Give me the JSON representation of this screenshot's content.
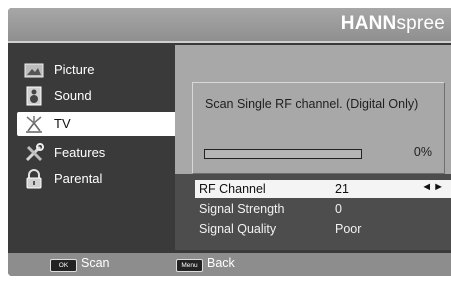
{
  "brand": {
    "bold": "HANN",
    "light": "spree"
  },
  "sidebar": {
    "items": [
      {
        "label": "Picture",
        "icon": "picture-icon",
        "selected": false
      },
      {
        "label": "Sound",
        "icon": "speaker-icon",
        "selected": false
      },
      {
        "label": "TV",
        "icon": "antenna-icon",
        "selected": true
      },
      {
        "label": "Features",
        "icon": "tools-icon",
        "selected": false
      },
      {
        "label": "Parental",
        "icon": "lock-icon",
        "selected": false
      }
    ]
  },
  "scan": {
    "title": "Scan Single RF channel. (Digital Only)",
    "progress_percent": 0,
    "progress_text": "0%"
  },
  "settings": {
    "rows": [
      {
        "label": "RF Channel",
        "value": "21",
        "selected": true,
        "arrows": "◄►"
      },
      {
        "label": "Signal Strength",
        "value": "0",
        "selected": false
      },
      {
        "label": "Signal Quality",
        "value": "Poor",
        "selected": false
      }
    ]
  },
  "footer": {
    "ok_key": "OK",
    "ok_label": "Scan",
    "menu_key": "Menu",
    "menu_label": "Back"
  },
  "colors": {
    "frame": "#3a3a3a",
    "panel": "#a8a8a8",
    "header": "#9a9a9a",
    "selected": "#ffffff"
  }
}
